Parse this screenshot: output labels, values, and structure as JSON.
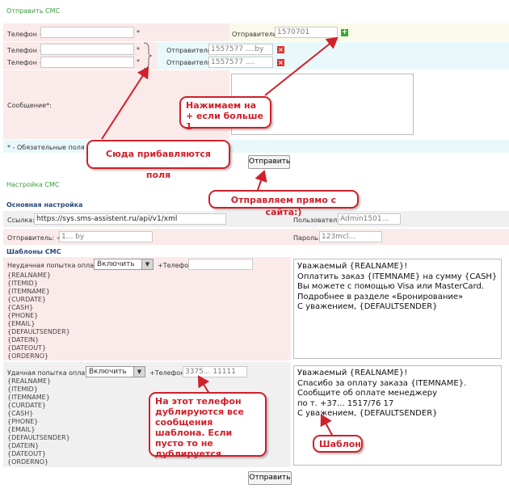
{
  "sms": {
    "title": "Отправить СМС",
    "phone_label": "Телефон +",
    "asterisk": "*",
    "sender_label": "Отправитель:",
    "sender_value_main": "1570701",
    "sender_value_2": "1557577 ....by",
    "sender_value_3": "1557577 ....",
    "message_label": "Сообщение*:",
    "required_note": "* - Обязательные поля",
    "send_label": "Отправить",
    "plus_symbol": "+",
    "delete_symbol": "×"
  },
  "settings": {
    "title": "Настройка СМС",
    "basic_title": "Основная настройка",
    "link_label": "Ссылка:",
    "link_value": "https://sys.sms-assistent.ru/api/v1/xml",
    "user_label": "Пользователь:",
    "user_value": "Admin1501...",
    "sender_label": "Отправитель: +",
    "sender_value": "1...     by",
    "password_label": "Пароль:",
    "password_value": "123mcl...",
    "templates_title": "Шаблоны СМС",
    "fail_label": "Неудачная попытка оплаты",
    "success_label": "Удачная попытка оплаты",
    "enable_option": "Включить",
    "phone_plus_label": "+Телефон",
    "phone_value_2": "3375... 11111",
    "variables": "{REALNAME}\n{ITEMID}\n{ITEMNAME}\n{CURDATE}\n{CASH}\n{PHONE}\n{EMAIL}\n{DEFAULTSENDER}\n{DATEIN}\n{DATEOUT}\n{ORDERNO}",
    "template_fail_text": "Уважаемый {REALNAME}!\nОплатить заказ {ITEMNAME} на сумму {CASH} Вы можете с помощью Visa или MasterCard.\nПодробнее в разделе «Бронирование»\nС уважением, {DEFAULTSENDER}",
    "template_success_text": "Уважаемый {REALNAME}!\nСпасибо за оплату заказа {ITEMNAME}.\nСообщите об оплате менеджеру\nпо т. +37... 1517/76 17\nС уважением, {DEFAULTSENDER}",
    "send_label": "Отправить"
  },
  "annotations": {
    "plus_note": "Нажимаем на + если больше 1",
    "fields_note": "Сюда прибавляются поля",
    "site_note": "Отправляем прямо с сайта:)",
    "phone_note": "На этот телефон дублируются все сообщения шаблона. Если пусто то не дублируется.",
    "template_note": "Шаблон"
  },
  "colors": {
    "section_title": "#3c9a3c",
    "callout": "#d0202a",
    "row_pink": "#fbeaea",
    "row_cyan": "#e9f8fb"
  }
}
